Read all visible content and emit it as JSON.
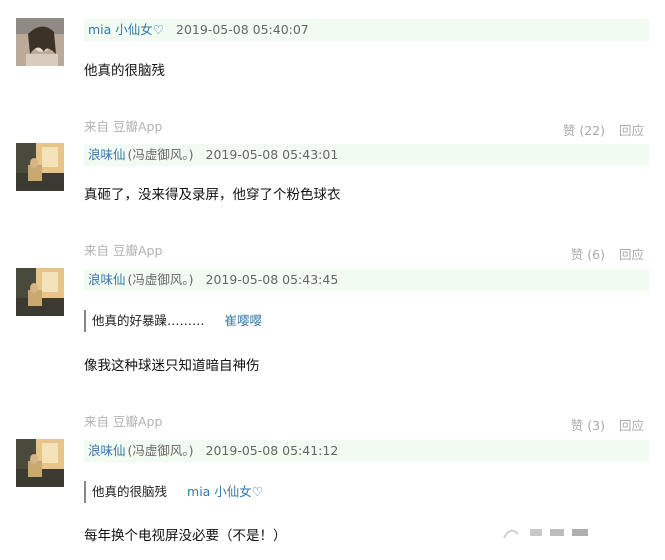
{
  "comments": [
    {
      "author": "mia 小仙女♡",
      "signature": "",
      "time": "2019-05-08 05:40:07",
      "content": "他真的很脑残",
      "source": "来自 豆瓣App",
      "vote_label": "赞 (22)",
      "reply_label": "回应"
    },
    {
      "author": "浪味仙",
      "signature": "(冯虚御风。)",
      "time": "2019-05-08 05:43:01",
      "content": "真砸了，没来得及录屏，他穿了个粉色球衣",
      "source": "来自 豆瓣App",
      "vote_label": "赞 (6)",
      "reply_label": "回应"
    },
    {
      "author": "浪味仙",
      "signature": "(冯虚御风。)",
      "time": "2019-05-08 05:43:45",
      "quote": {
        "text": "他真的好暴躁………",
        "author": "崔嘤嘤"
      },
      "content": "像我这种球迷只知道暗自神伤",
      "source": "来自 豆瓣App",
      "vote_label": "赞 (3)",
      "reply_label": "回应"
    },
    {
      "author": "浪味仙",
      "signature": "(冯虚御风。)",
      "time": "2019-05-08 05:41:12",
      "quote": {
        "text": "他真的很脑残",
        "author": "mia 小仙女♡"
      },
      "content": "每年换个电视屏没必要（不是！）"
    }
  ]
}
